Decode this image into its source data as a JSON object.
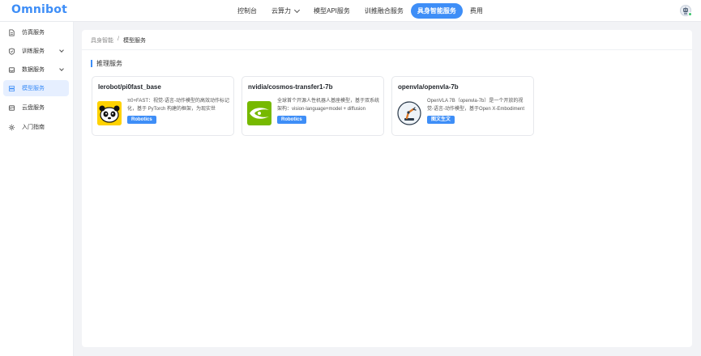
{
  "app": {
    "logo": "Omnibot"
  },
  "header": {
    "nav": [
      {
        "label": "控制台",
        "dropdown": false,
        "active": false
      },
      {
        "label": "云算力",
        "dropdown": true,
        "active": false
      },
      {
        "label": "模型API服务",
        "dropdown": false,
        "active": false
      },
      {
        "label": "训推融合服务",
        "dropdown": false,
        "active": false
      },
      {
        "label": "具身智能服务",
        "dropdown": false,
        "active": true
      },
      {
        "label": "费用",
        "dropdown": false,
        "active": false
      }
    ],
    "avatar_icon": "robot-avatar-icon"
  },
  "sidebar": {
    "items": [
      {
        "label": "仿真服务",
        "icon": "document-icon",
        "expandable": false,
        "active": false
      },
      {
        "label": "训练服务",
        "icon": "shield-icon",
        "expandable": true,
        "active": false
      },
      {
        "label": "数据服务",
        "icon": "inbox-icon",
        "expandable": true,
        "active": false
      },
      {
        "label": "模型服务",
        "icon": "stack-icon",
        "expandable": false,
        "active": true
      },
      {
        "label": "云盘服务",
        "icon": "disk-icon",
        "expandable": false,
        "active": false
      },
      {
        "label": "入门指南",
        "icon": "gear-icon",
        "expandable": false,
        "active": false
      }
    ]
  },
  "main": {
    "breadcrumb": {
      "parent": "具身智能",
      "separator": "/",
      "current": "模型服务"
    },
    "section_title": "推理服务",
    "cards": [
      {
        "title": "lerobot/pi0fast_base",
        "description": "π0+FAST：视觉-语言-动作模型的高效动作标记化，基于 PyTorch 构建的框架，为现实世",
        "tag": "Robotics",
        "logo": "panda-logo-icon"
      },
      {
        "title": "nvidia/cosmos-transfer1-7b",
        "description": "全球首个开源人性机器人基座模型，基于双系统架构：vision-language+model + diffusion",
        "tag": "Robotics",
        "logo": "nvidia-logo-icon"
      },
      {
        "title": "openvla/openvla-7b",
        "description": "OpenVLA 7B（openvla-7b）是一个开放的视觉-语言-动作模型，基于Open X-Embodiment",
        "tag": "图文生文",
        "logo": "robot-arm-logo-icon"
      }
    ]
  },
  "colors": {
    "accent": "#3e8ef7",
    "active_bg": "#e6efff",
    "nvidia_green": "#76b900"
  }
}
